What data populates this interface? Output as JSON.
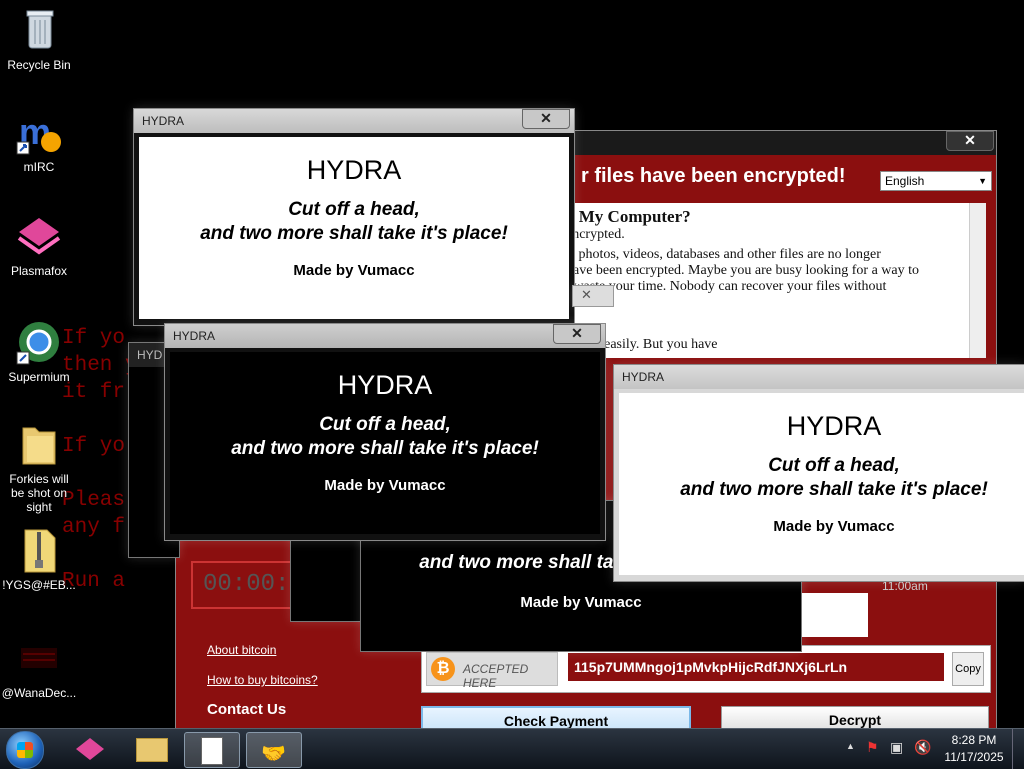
{
  "desktop": {
    "icons": [
      {
        "label": "Recycle Bin"
      },
      {
        "label": "mIRC"
      },
      {
        "label": "Plasmafox"
      },
      {
        "label": "Supermium"
      },
      {
        "label": "Forkies will be shot on sight"
      },
      {
        "label": "!YGS@#EB..."
      },
      {
        "label": "@WanaDec..."
      }
    ],
    "bg_lines": [
      "If yo",
      "then yo",
      "it fr",
      "",
      "If yo",
      "",
      "Pleas",
      "any f",
      "",
      "Run a"
    ]
  },
  "hydra": {
    "window_title": "HYDRA",
    "heading": "HYDRA",
    "line1": "Cut off a head,",
    "line2": "and two more shall take it's place!",
    "made_by": "Made by Vumacc",
    "close": "✕"
  },
  "wannacry": {
    "header": "r files have been encrypted!",
    "language": "English",
    "q1": "o My Computer?",
    "p1": "encrypted.",
    "p2": "s, photos, videos, databases and other files are no longer",
    "p3": "have been encrypted. Maybe you are busy looking for a way to",
    "p4": "t waste your time. Nobody can recover your files without",
    "q2": "?",
    "p5": "...files easily. But you have",
    "timer": "00:00:",
    "about_bitcoin": "About bitcoin",
    "how_to_buy": "How to buy bitcoins?",
    "contact": "Contact Us",
    "accepted": "ACCEPTED HERE",
    "address": "115p7UMMngoj1pMvkpHijcRdfJNXj6LrLn",
    "copy": "Copy",
    "check_payment": "Check Payment",
    "decrypt": "Decrypt",
    "timebox_partial": "11:00am"
  },
  "taskbar": {
    "time": "8:28 PM",
    "date": "11/17/2025"
  },
  "colors": {
    "accent_red": "#8b0f0f",
    "link_blue": "#bfe4ff"
  }
}
